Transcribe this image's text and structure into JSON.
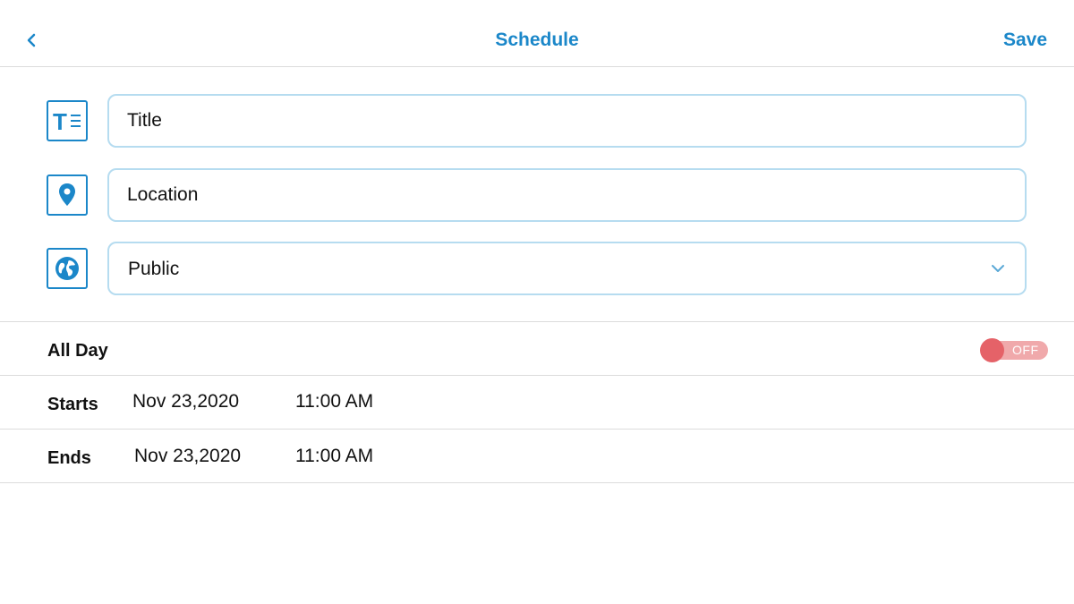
{
  "header": {
    "title": "Schedule",
    "save_label": "Save",
    "back_icon": "chevron-left-icon"
  },
  "form": {
    "title_field": {
      "placeholder": "Title",
      "icon": "text-format-icon"
    },
    "location_field": {
      "placeholder": "Location",
      "icon": "location-pin-icon"
    },
    "visibility": {
      "value": "Public",
      "icon": "globe-icon",
      "dropdown_icon": "chevron-down-icon"
    }
  },
  "all_day": {
    "label": "All Day",
    "toggle_label": "OFF",
    "enabled": false
  },
  "starts": {
    "label": "Starts",
    "date": "Nov 23,2020",
    "time": "11:00 AM"
  },
  "ends": {
    "label": "Ends",
    "date": "Nov 23,2020",
    "time": "11:00 AM"
  },
  "colors": {
    "accent": "#1b87c9",
    "field_border": "#b6dcf0",
    "toggle_knob": "#e56268",
    "toggle_track": "#f0a9ab",
    "divider": "#dcdcdc"
  }
}
